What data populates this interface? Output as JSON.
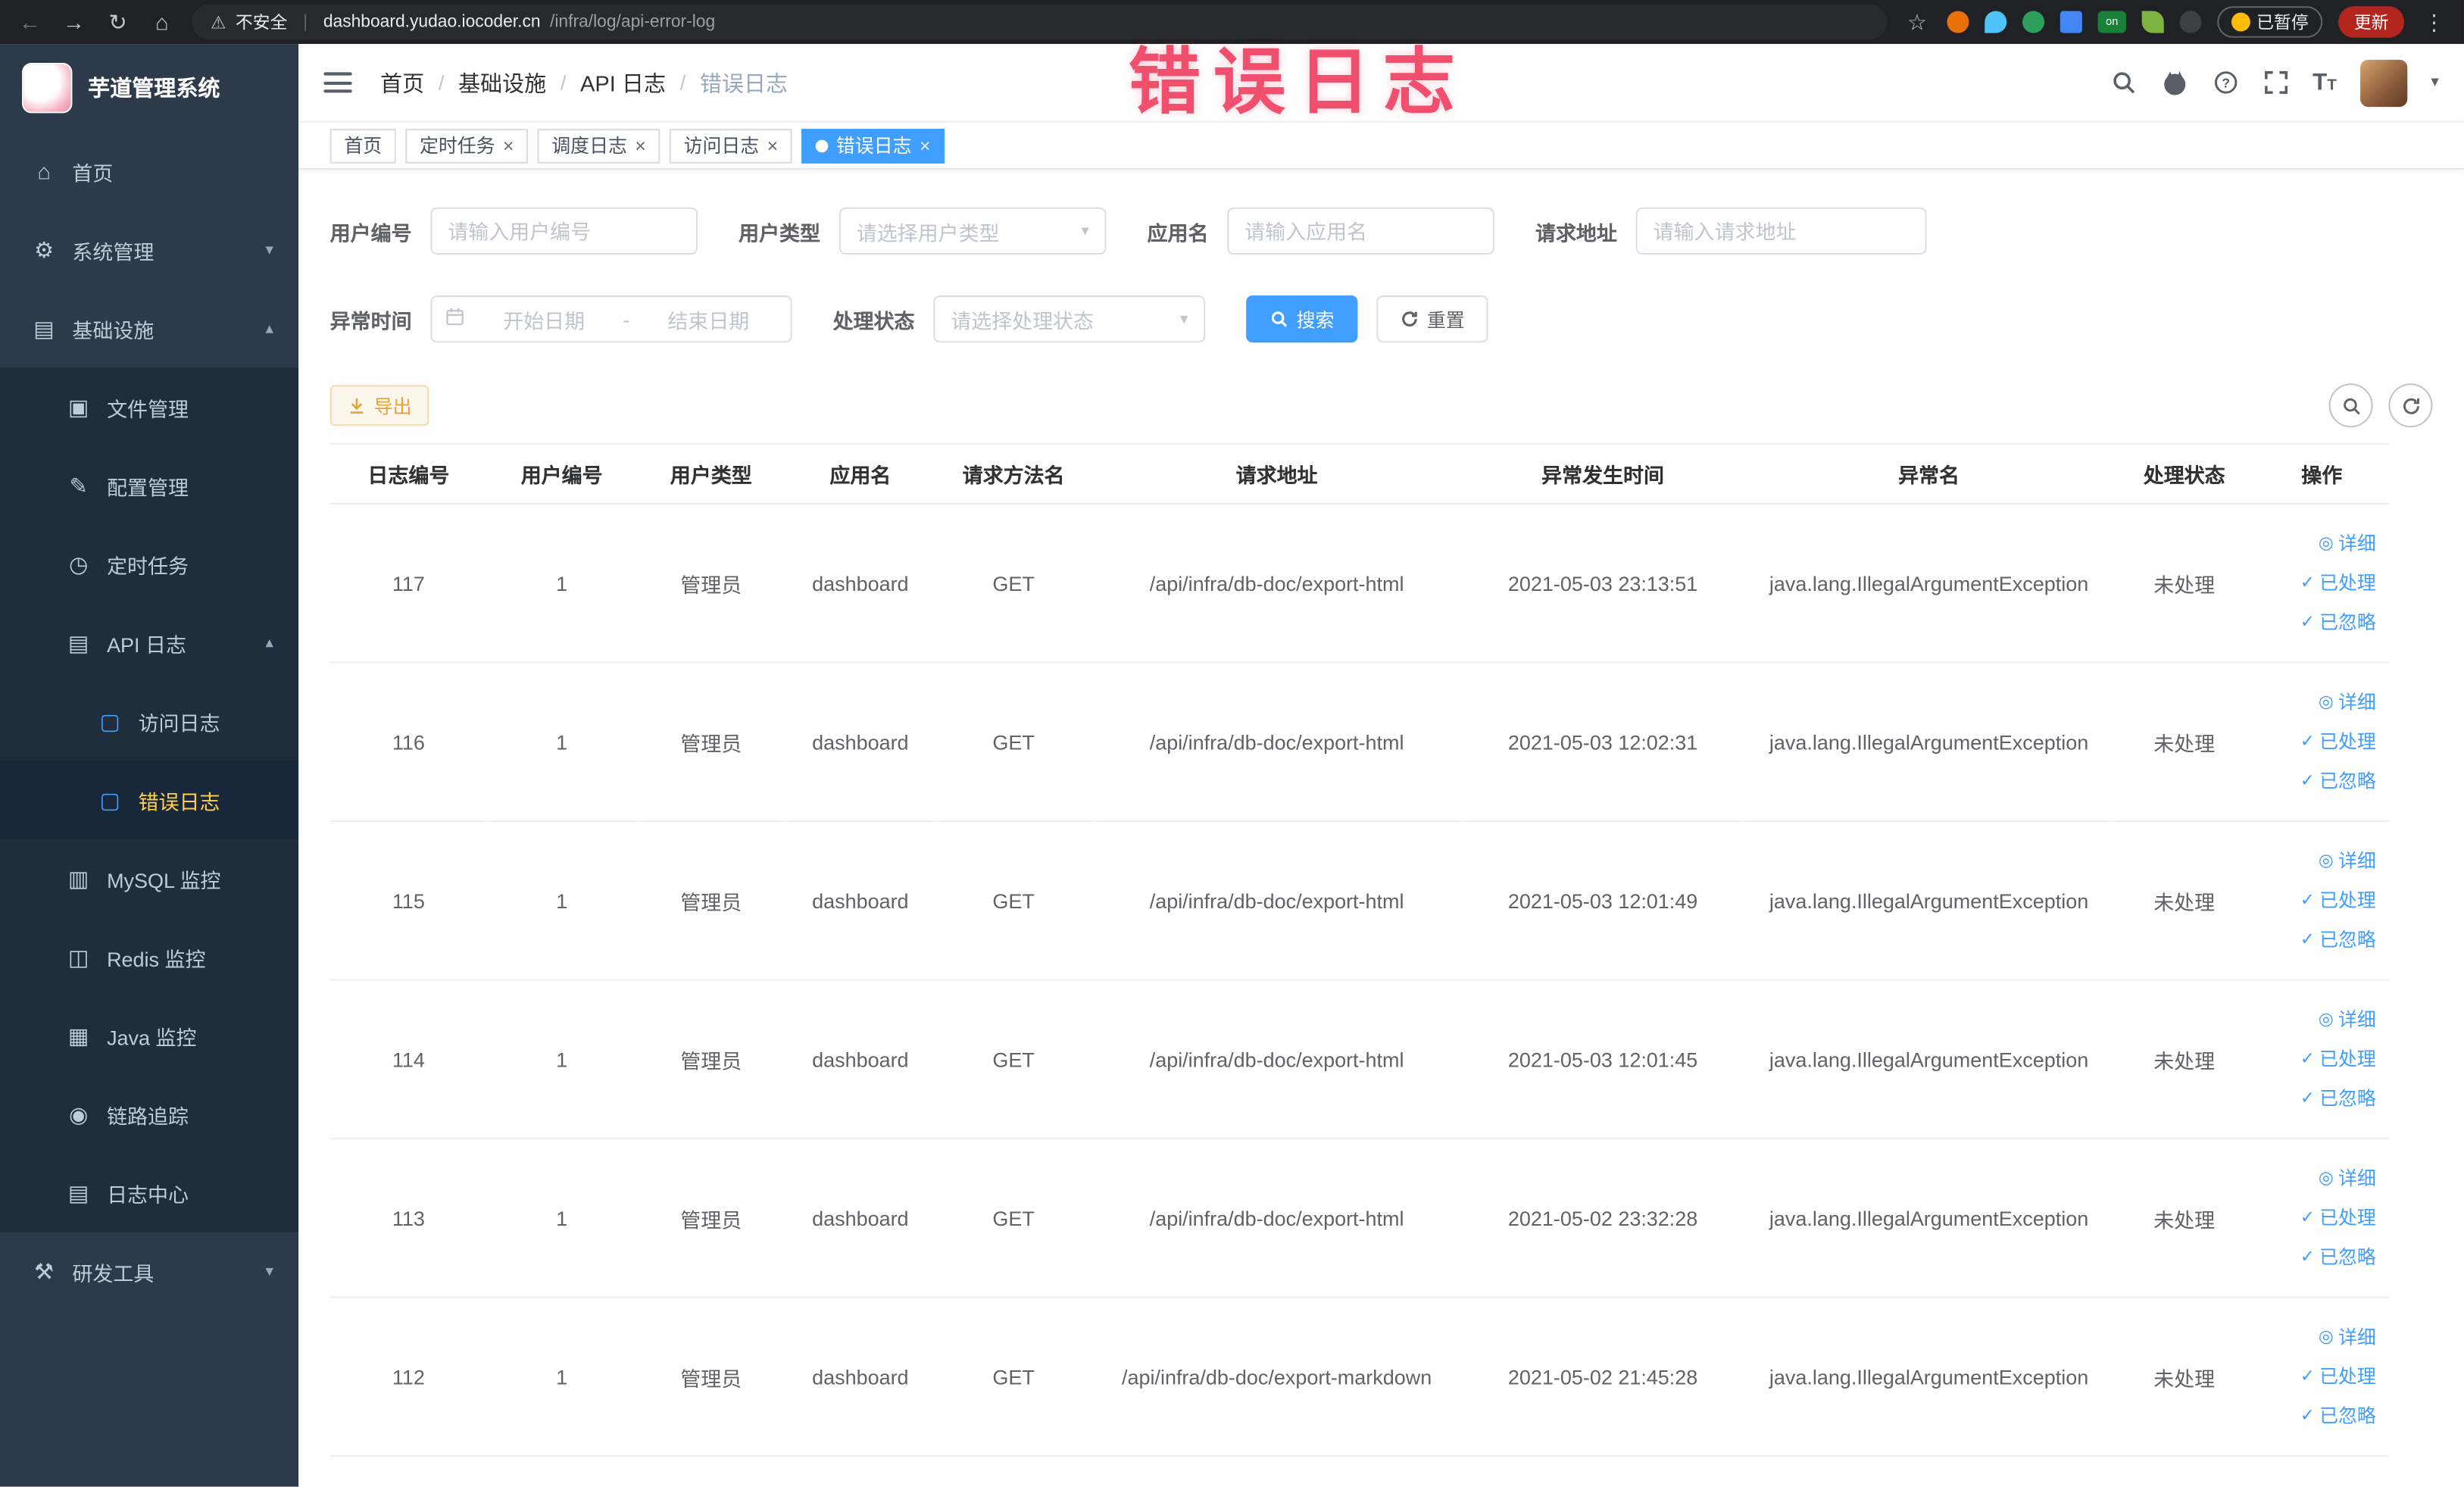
{
  "colors": {
    "accent": "#409eff",
    "active_tab": "#409eff",
    "annotation_red": "#f0506e",
    "warning": "#e6a23c",
    "sidebar_bg": "#2d3a4b",
    "submenu_bg": "#1f2d3d",
    "active_menu_text": "#ffd04b"
  },
  "browser": {
    "security_label": "不安全",
    "url_host": "dashboard.yudao.iocoder.cn",
    "url_path": "/infra/log/api-error-log",
    "on_badge": "on",
    "paused_badge": "已暂停",
    "update_button": "更新"
  },
  "sidebar": {
    "app_title": "芋道管理系统",
    "items": [
      {
        "label": "首页",
        "icon": "home-icon",
        "level": 1,
        "expandable": false,
        "expanded": false,
        "active": false
      },
      {
        "label": "系统管理",
        "icon": "gear-icon",
        "level": 1,
        "expandable": true,
        "expanded": false,
        "active": false
      },
      {
        "label": "基础设施",
        "icon": "infra-icon",
        "level": 1,
        "expandable": true,
        "expanded": true,
        "active": false
      },
      {
        "label": "文件管理",
        "icon": "file-icon",
        "level": 2,
        "expandable": false,
        "expanded": false,
        "active": false
      },
      {
        "label": "配置管理",
        "icon": "config-icon",
        "level": 2,
        "expandable": false,
        "expanded": false,
        "active": false
      },
      {
        "label": "定时任务",
        "icon": "timer-icon",
        "level": 2,
        "expandable": false,
        "expanded": false,
        "active": false
      },
      {
        "label": "API 日志",
        "icon": "api-log-icon",
        "level": 2,
        "expandable": true,
        "expanded": true,
        "active": false
      },
      {
        "label": "访问日志",
        "icon": "doc-icon",
        "level": 3,
        "expandable": false,
        "expanded": false,
        "active": false
      },
      {
        "label": "错误日志",
        "icon": "doc-icon",
        "level": 3,
        "expandable": false,
        "expanded": false,
        "active": true
      },
      {
        "label": "MySQL 监控",
        "icon": "mysql-icon",
        "level": 2,
        "expandable": false,
        "expanded": false,
        "active": false
      },
      {
        "label": "Redis 监控",
        "icon": "redis-icon",
        "level": 2,
        "expandable": false,
        "expanded": false,
        "active": false
      },
      {
        "label": "Java 监控",
        "icon": "java-icon",
        "level": 2,
        "expandable": false,
        "expanded": false,
        "active": false
      },
      {
        "label": "链路追踪",
        "icon": "trace-icon",
        "level": 2,
        "expandable": false,
        "expanded": false,
        "active": false
      },
      {
        "label": "日志中心",
        "icon": "log-center-icon",
        "level": 2,
        "expandable": false,
        "expanded": false,
        "active": false
      },
      {
        "label": "研发工具",
        "icon": "tools-icon",
        "level": 1,
        "expandable": true,
        "expanded": false,
        "active": false
      }
    ]
  },
  "header": {
    "breadcrumb": [
      "首页",
      "基础设施",
      "API 日志",
      "错误日志"
    ],
    "annotation": "错误日志"
  },
  "tabs": [
    {
      "label": "首页",
      "closable": false,
      "active": false
    },
    {
      "label": "定时任务",
      "closable": true,
      "active": false
    },
    {
      "label": "调度日志",
      "closable": true,
      "active": false
    },
    {
      "label": "访问日志",
      "closable": true,
      "active": false
    },
    {
      "label": "错误日志",
      "closable": true,
      "active": true
    }
  ],
  "filters": {
    "user_id_label": "用户编号",
    "user_id_placeholder": "请输入用户编号",
    "user_type_label": "用户类型",
    "user_type_placeholder": "请选择用户类型",
    "app_name_label": "应用名",
    "app_name_placeholder": "请输入应用名",
    "request_url_label": "请求地址",
    "request_url_placeholder": "请输入请求地址",
    "exception_time_label": "异常时间",
    "start_date_placeholder": "开始日期",
    "range_separator": "-",
    "end_date_placeholder": "结束日期",
    "process_status_label": "处理状态",
    "process_status_placeholder": "请选择处理状态",
    "search_button": "搜索",
    "reset_button": "重置"
  },
  "toolbar": {
    "export_button": "导出"
  },
  "table": {
    "columns": [
      "日志编号",
      "用户编号",
      "用户类型",
      "应用名",
      "请求方法名",
      "请求地址",
      "异常发生时间",
      "异常名",
      "处理状态",
      "操作"
    ],
    "rows": [
      {
        "id": "117",
        "user_id": "1",
        "user_type": "管理员",
        "app": "dashboard",
        "method": "GET",
        "url": "/api/infra/db-doc/export-html",
        "time": "2021-05-03 23:13:51",
        "exception": "java.lang.IllegalArgumentException",
        "status": "未处理"
      },
      {
        "id": "116",
        "user_id": "1",
        "user_type": "管理员",
        "app": "dashboard",
        "method": "GET",
        "url": "/api/infra/db-doc/export-html",
        "time": "2021-05-03 12:02:31",
        "exception": "java.lang.IllegalArgumentException",
        "status": "未处理"
      },
      {
        "id": "115",
        "user_id": "1",
        "user_type": "管理员",
        "app": "dashboard",
        "method": "GET",
        "url": "/api/infra/db-doc/export-html",
        "time": "2021-05-03 12:01:49",
        "exception": "java.lang.IllegalArgumentException",
        "status": "未处理"
      },
      {
        "id": "114",
        "user_id": "1",
        "user_type": "管理员",
        "app": "dashboard",
        "method": "GET",
        "url": "/api/infra/db-doc/export-html",
        "time": "2021-05-03 12:01:45",
        "exception": "java.lang.IllegalArgumentException",
        "status": "未处理"
      },
      {
        "id": "113",
        "user_id": "1",
        "user_type": "管理员",
        "app": "dashboard",
        "method": "GET",
        "url": "/api/infra/db-doc/export-html",
        "time": "2021-05-02 23:32:28",
        "exception": "java.lang.IllegalArgumentException",
        "status": "未处理"
      },
      {
        "id": "112",
        "user_id": "1",
        "user_type": "管理员",
        "app": "dashboard",
        "method": "GET",
        "url": "/api/infra/db-doc/export-markdown",
        "time": "2021-05-02 21:45:28",
        "exception": "java.lang.IllegalArgumentException",
        "status": "未处理"
      }
    ],
    "actions": [
      {
        "label": "详细",
        "icon": "eye-icon",
        "glyph": "◎"
      },
      {
        "label": "已处理",
        "icon": "check-icon",
        "glyph": "✓"
      },
      {
        "label": "已忽略",
        "icon": "check-icon",
        "glyph": "✓"
      }
    ]
  }
}
